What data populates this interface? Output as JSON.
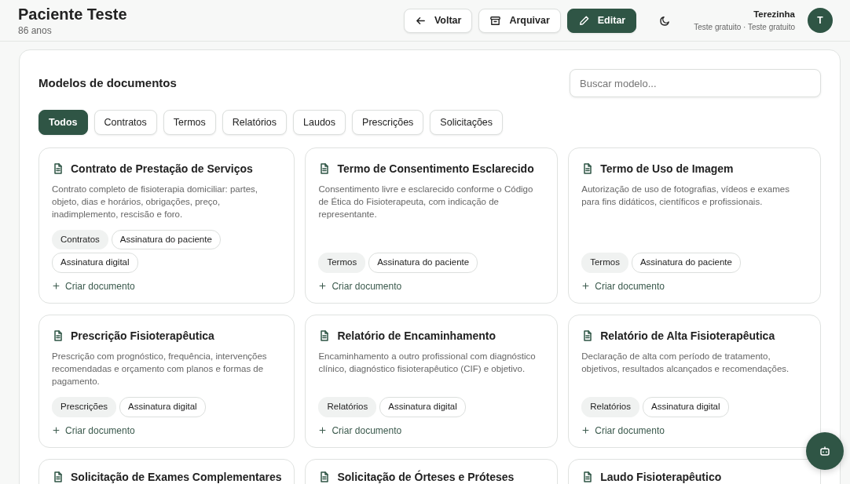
{
  "header": {
    "title": "Paciente Teste",
    "subtitle": "86 anos",
    "buttons": [
      {
        "label": "Voltar",
        "kind": "back",
        "primary": false
      },
      {
        "label": "Arquivar",
        "kind": "archive",
        "primary": false
      },
      {
        "label": "Editar",
        "kind": "edit",
        "primary": true
      }
    ],
    "user": {
      "name": "Terezinha",
      "plan": "Teste gratuito · Teste gratuito",
      "initial": "T"
    }
  },
  "panel": {
    "title": "Modelos de documentos",
    "search": {
      "placeholder": "Buscar modelo..."
    },
    "filters": [
      {
        "label": "Todos",
        "selected": true
      },
      {
        "label": "Contratos",
        "selected": false
      },
      {
        "label": "Termos",
        "selected": false
      },
      {
        "label": "Relatórios",
        "selected": false
      },
      {
        "label": "Laudos",
        "selected": false
      },
      {
        "label": "Prescrições",
        "selected": false
      },
      {
        "label": "Solicitações",
        "selected": false
      }
    ],
    "templates": [
      {
        "title": "Contrato de Prestação de Serviços",
        "description": "Contrato completo de fisioterapia domiciliar: partes, objeto, dias e horários, obrigações, preço, inadimplemento, rescisão e foro.",
        "tags": [
          {
            "label": "Contratos",
            "kind": "category"
          },
          {
            "label": "Assinatura do paciente",
            "kind": "feature"
          },
          {
            "label": "Assinatura digital",
            "kind": "feature"
          }
        ],
        "action": "Criar documento"
      },
      {
        "title": "Termo de Consentimento Esclarecido",
        "description": "Consentimento livre e esclarecido conforme o Código de Ética do Fisioterapeuta, com indicação de representante.",
        "tags": [
          {
            "label": "Termos",
            "kind": "category"
          },
          {
            "label": "Assinatura do paciente",
            "kind": "feature"
          }
        ],
        "action": "Criar documento"
      },
      {
        "title": "Termo de Uso de Imagem",
        "description": "Autorização de uso de fotografias, vídeos e exames para fins didáticos, científicos e profissionais.",
        "tags": [
          {
            "label": "Termos",
            "kind": "category"
          },
          {
            "label": "Assinatura do paciente",
            "kind": "feature"
          }
        ],
        "action": "Criar documento"
      },
      {
        "title": "Prescrição Fisioterapêutica",
        "description": "Prescrição com prognóstico, frequência, intervenções recomendadas e orçamento com planos e formas de pagamento.",
        "tags": [
          {
            "label": "Prescrições",
            "kind": "category"
          },
          {
            "label": "Assinatura digital",
            "kind": "feature"
          }
        ],
        "action": "Criar documento"
      },
      {
        "title": "Relatório de Encaminhamento",
        "description": "Encaminhamento a outro profissional com diagnóstico clínico, diagnóstico fisioterapêutico (CIF) e objetivo.",
        "tags": [
          {
            "label": "Relatórios",
            "kind": "category"
          },
          {
            "label": "Assinatura digital",
            "kind": "feature"
          }
        ],
        "action": "Criar documento"
      },
      {
        "title": "Relatório de Alta Fisioterapêutica",
        "description": "Declaração de alta com período de tratamento, objetivos, resultados alcançados e recomendações.",
        "tags": [
          {
            "label": "Relatórios",
            "kind": "category"
          },
          {
            "label": "Assinatura digital",
            "kind": "feature"
          }
        ],
        "action": "Criar documento"
      },
      {
        "title": "Solicitação de Exames Complementares"
      },
      {
        "title": "Solicitação de Órteses e Próteses"
      },
      {
        "title": "Laudo Fisioterapêutico"
      }
    ]
  }
}
